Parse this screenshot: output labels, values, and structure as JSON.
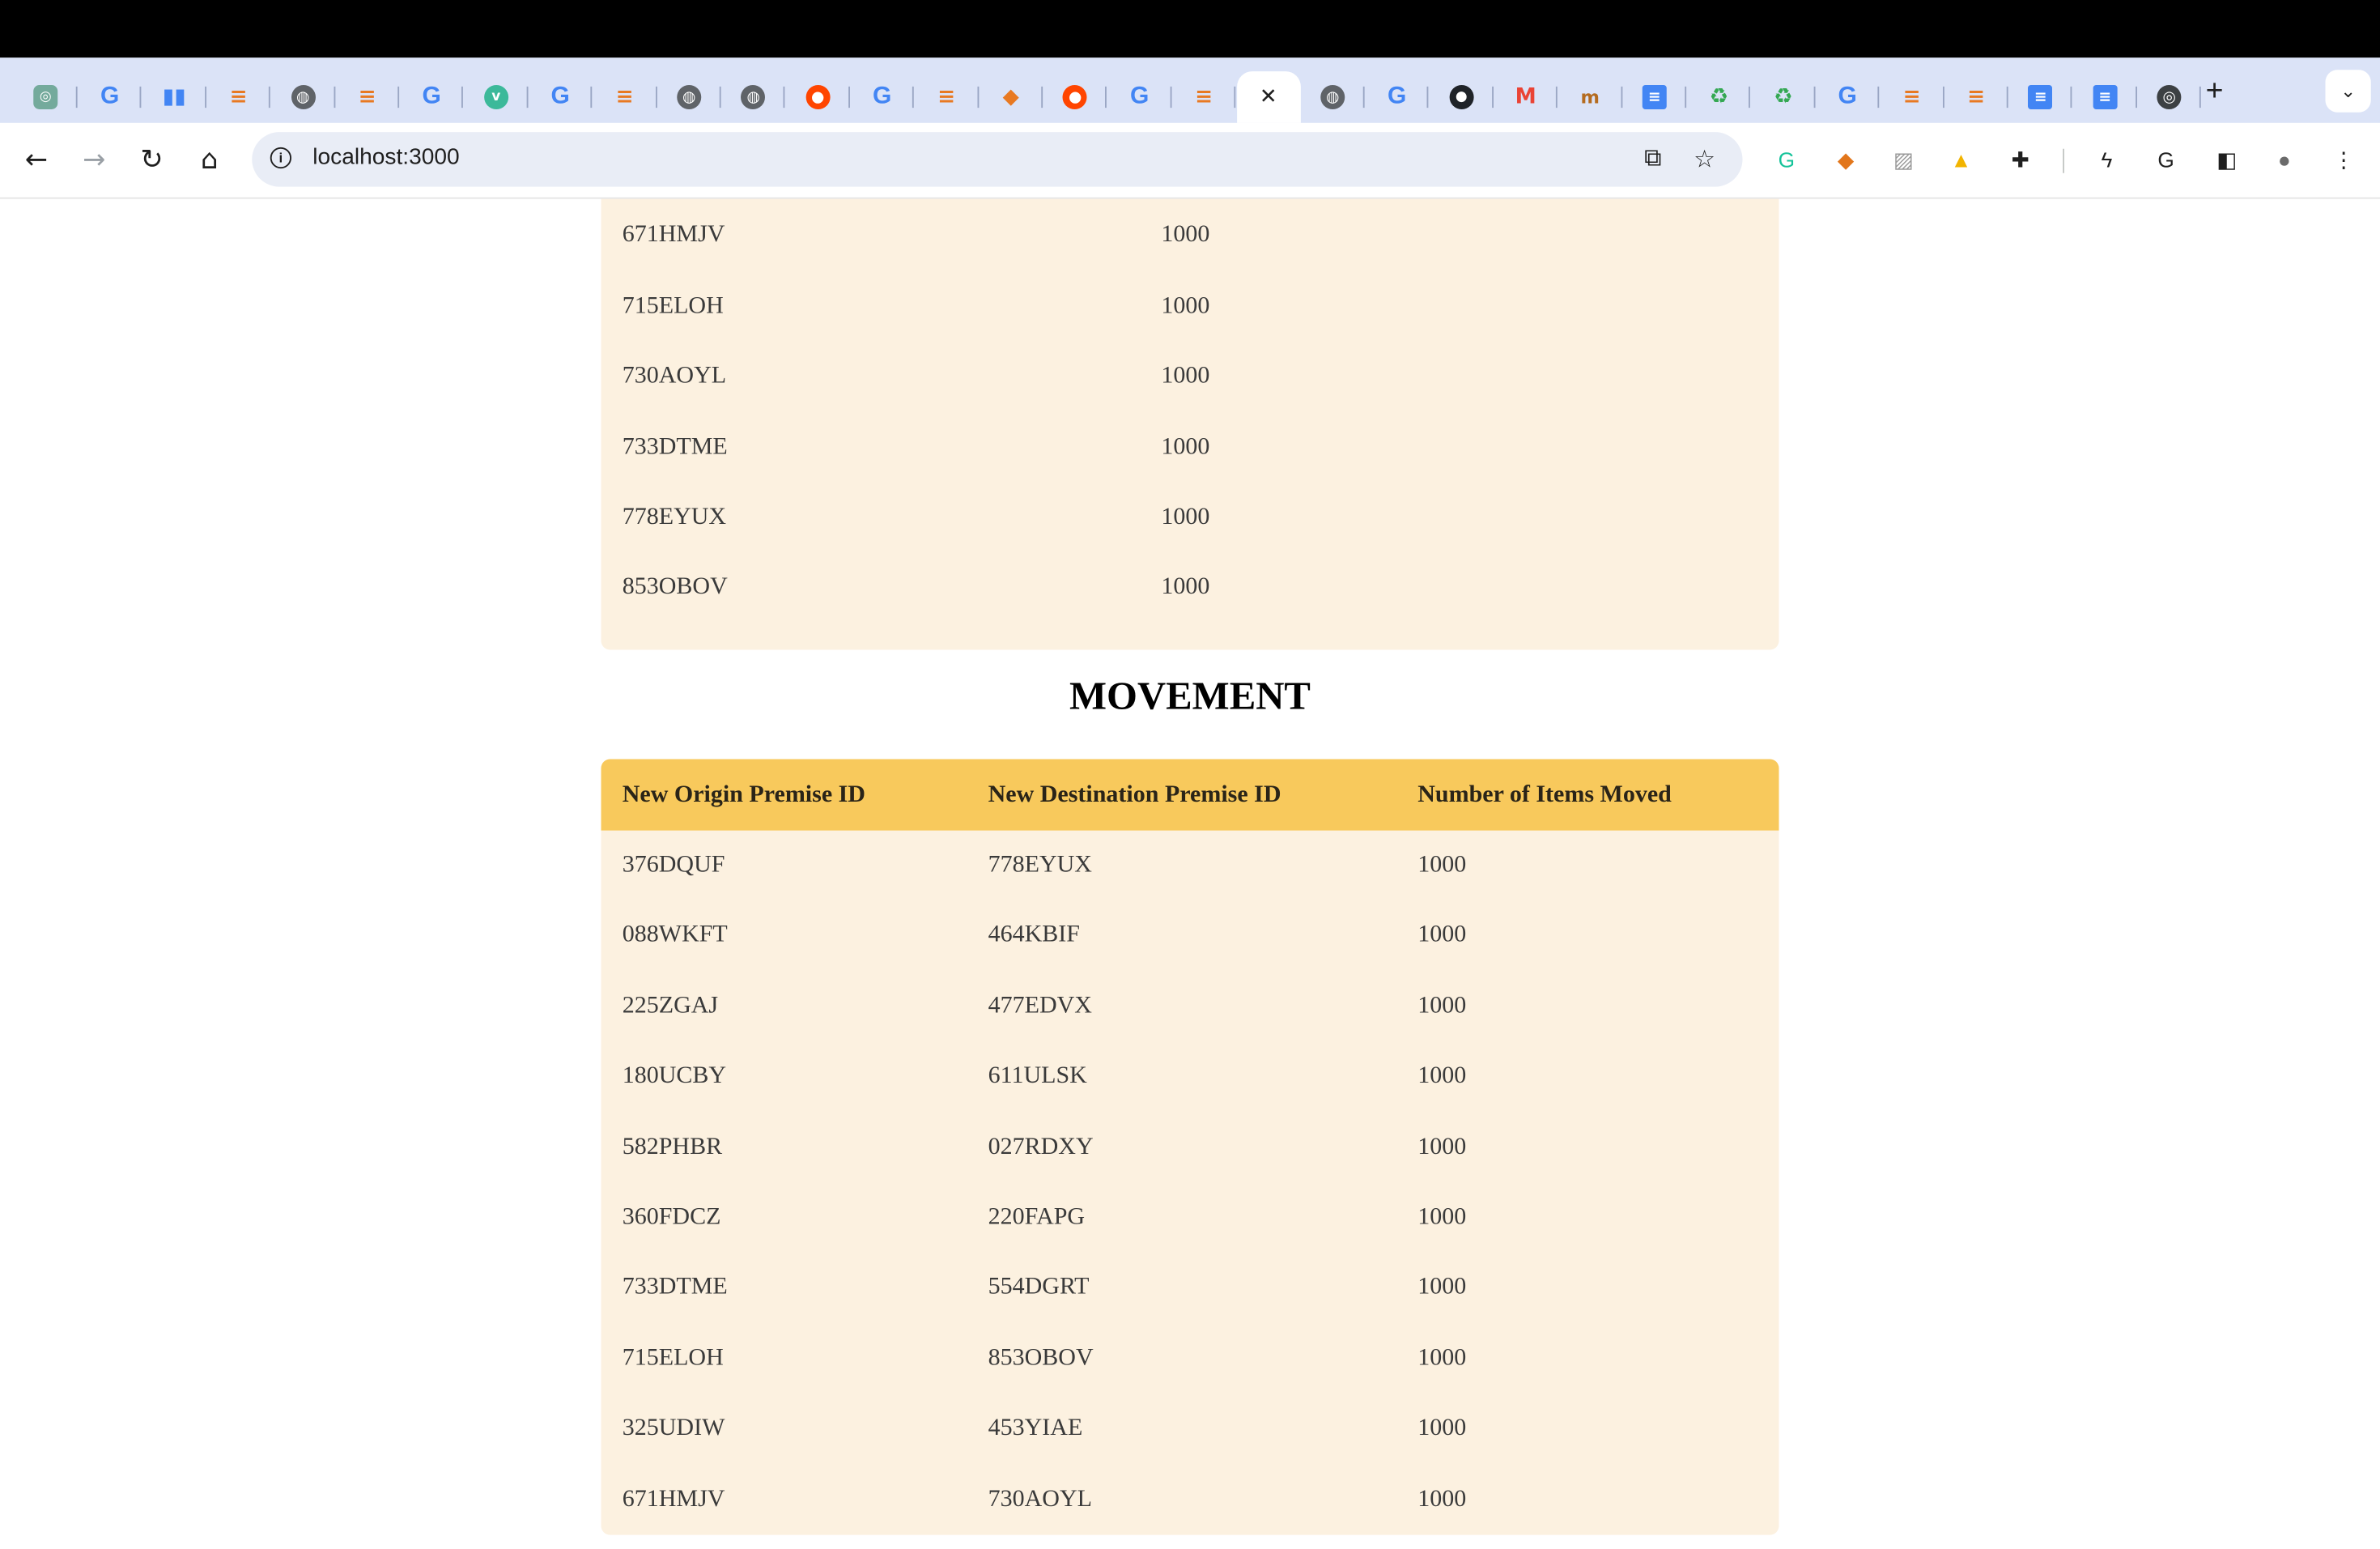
{
  "browser": {
    "tabs": [
      {
        "icon": "chatgpt-icon",
        "glyph": "◎"
      },
      {
        "icon": "google-icon",
        "glyph": "G"
      },
      {
        "icon": "analytics-icon",
        "glyph": "▮▮"
      },
      {
        "icon": "stackoverflow-icon",
        "glyph": "≡"
      },
      {
        "icon": "globe-icon",
        "glyph": "◍"
      },
      {
        "icon": "stackoverflow-icon",
        "glyph": "≡"
      },
      {
        "icon": "google-icon",
        "glyph": "G"
      },
      {
        "icon": "vue-icon",
        "glyph": "v"
      },
      {
        "icon": "google-icon",
        "glyph": "G"
      },
      {
        "icon": "stackoverflow-icon",
        "glyph": "≡"
      },
      {
        "icon": "globe-icon",
        "glyph": "◍"
      },
      {
        "icon": "globe-icon",
        "glyph": "◍"
      },
      {
        "icon": "reddit-icon",
        "glyph": "●"
      },
      {
        "icon": "google-icon",
        "glyph": "G"
      },
      {
        "icon": "stackoverflow-icon",
        "glyph": "≡"
      },
      {
        "icon": "bird-icon",
        "glyph": "◆"
      },
      {
        "icon": "reddit-icon",
        "glyph": "●"
      },
      {
        "icon": "google-icon",
        "glyph": "G"
      },
      {
        "icon": "stackoverflow-icon",
        "glyph": "≡"
      },
      {
        "icon": "close-icon",
        "glyph": "✕",
        "active": true
      },
      {
        "icon": "globe-icon",
        "glyph": "◍"
      },
      {
        "icon": "google-icon",
        "glyph": "G"
      },
      {
        "icon": "github-icon",
        "glyph": "●"
      },
      {
        "icon": "gmail-icon",
        "glyph": "M"
      },
      {
        "icon": "mn-icon",
        "glyph": "m"
      },
      {
        "icon": "docs-icon",
        "glyph": "≡"
      },
      {
        "icon": "recycle-icon",
        "glyph": "♻"
      },
      {
        "icon": "recycle-icon",
        "glyph": "♻"
      },
      {
        "icon": "google-icon",
        "glyph": "G"
      },
      {
        "icon": "stackoverflow-icon",
        "glyph": "≡"
      },
      {
        "icon": "stackoverflow-icon",
        "glyph": "≡"
      },
      {
        "icon": "docs-icon",
        "glyph": "≡"
      },
      {
        "icon": "docs-icon",
        "glyph": "≡"
      },
      {
        "icon": "chrome-icon",
        "glyph": "◎"
      }
    ],
    "new_tab_glyph": "+",
    "tab_search_glyph": "⌄",
    "url": "localhost:3000",
    "extensions": [
      {
        "icon": "grammarly-icon",
        "glyph": "G",
        "color": "#15c39a"
      },
      {
        "icon": "metamask-icon",
        "glyph": "◆",
        "color": "#e2761b"
      },
      {
        "icon": "ext-icon",
        "glyph": "▨",
        "color": "#9a9a9a"
      },
      {
        "icon": "lock-ext-icon",
        "glyph": "▲",
        "color": "#f2b400"
      },
      {
        "icon": "puzzle-icon",
        "glyph": "✚",
        "color": "#1f1f1f"
      },
      {
        "icon": "bolt-icon",
        "glyph": "ϟ",
        "color": "#1f1f1f"
      },
      {
        "icon": "google-account-icon",
        "glyph": "G",
        "color": "#1f1f1f"
      },
      {
        "icon": "side-panel-icon",
        "glyph": "◧",
        "color": "#1f1f1f"
      },
      {
        "icon": "avatar-icon",
        "glyph": "●",
        "color": "#6b6b6b"
      },
      {
        "icon": "menu-icon",
        "glyph": "⋮",
        "color": "#1f1f1f"
      }
    ]
  },
  "top_table": {
    "partial_row": {
      "id": "",
      "amount": ""
    },
    "rows": [
      {
        "id": "671HMJV",
        "amount": "1000"
      },
      {
        "id": "715ELOH",
        "amount": "1000"
      },
      {
        "id": "730AOYL",
        "amount": "1000"
      },
      {
        "id": "733DTME",
        "amount": "1000"
      },
      {
        "id": "778EYUX",
        "amount": "1000"
      },
      {
        "id": "853OBOV",
        "amount": "1000"
      }
    ]
  },
  "movement": {
    "title": "MOVEMENT",
    "headers": [
      "New Origin Premise ID",
      "New Destination Premise ID",
      "Number of Items Moved"
    ],
    "rows": [
      [
        "376DQUF",
        "778EYUX",
        "1000"
      ],
      [
        "088WKFT",
        "464KBIF",
        "1000"
      ],
      [
        "225ZGAJ",
        "477EDVX",
        "1000"
      ],
      [
        "180UCBY",
        "611ULSK",
        "1000"
      ],
      [
        "582PHBR",
        "027RDXY",
        "1000"
      ],
      [
        "360FDCZ",
        "220FAPG",
        "1000"
      ],
      [
        "733DTME",
        "554DGRT",
        "1000"
      ],
      [
        "715ELOH",
        "853OBOV",
        "1000"
      ],
      [
        "325UDIW",
        "453YIAE",
        "1000"
      ],
      [
        "671HMJV",
        "730AOYL",
        "1000"
      ]
    ]
  }
}
